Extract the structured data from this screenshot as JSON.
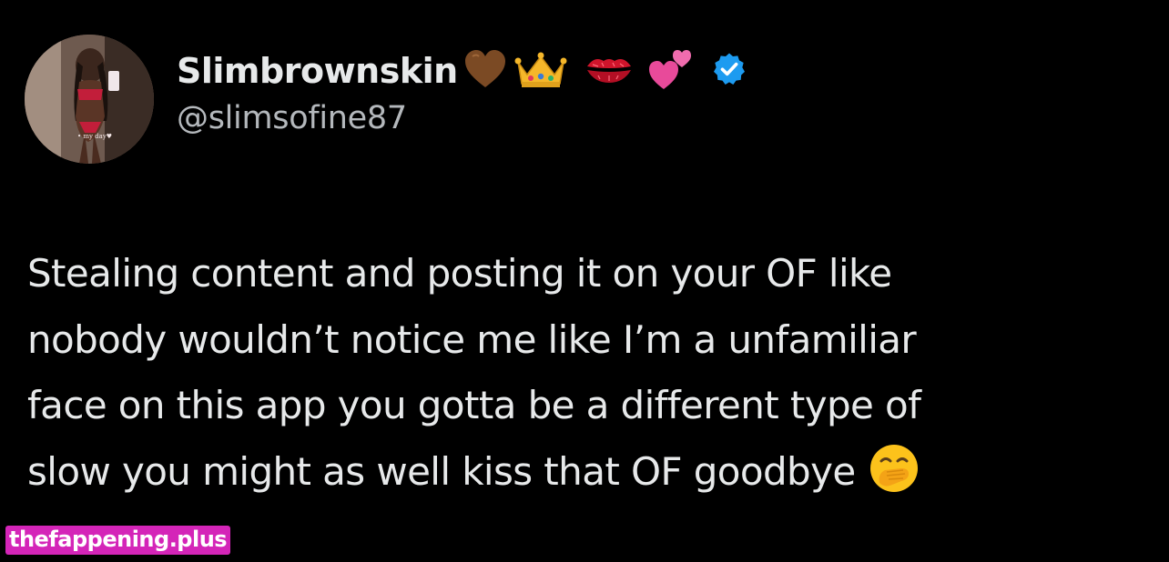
{
  "profile": {
    "display_name": "Slimbrownskin",
    "handle": "@slimsofine87",
    "avatar_caption": "• my day♥",
    "name_emojis": [
      "brown-heart-icon",
      "crown-icon",
      "kiss-mark-icon",
      "two-hearts-icon"
    ],
    "verified": true
  },
  "tweet": {
    "lines": [
      "Stealing content and posting it on your OF like",
      "nobody wouldn’t notice me like I’m a unfamiliar",
      "face on this app you gotta be a different type of",
      "slow you might as well kiss that OF goodbye"
    ],
    "trailing_emoji": "hand-over-mouth-icon"
  },
  "watermark": {
    "text": "thefappening.plus"
  },
  "colors": {
    "background": "#000000",
    "text_primary": "#e7e9ea",
    "text_secondary": "#b4b8bc",
    "verified_blue": "#1d9bf0",
    "watermark_bg": "#d425b8"
  }
}
